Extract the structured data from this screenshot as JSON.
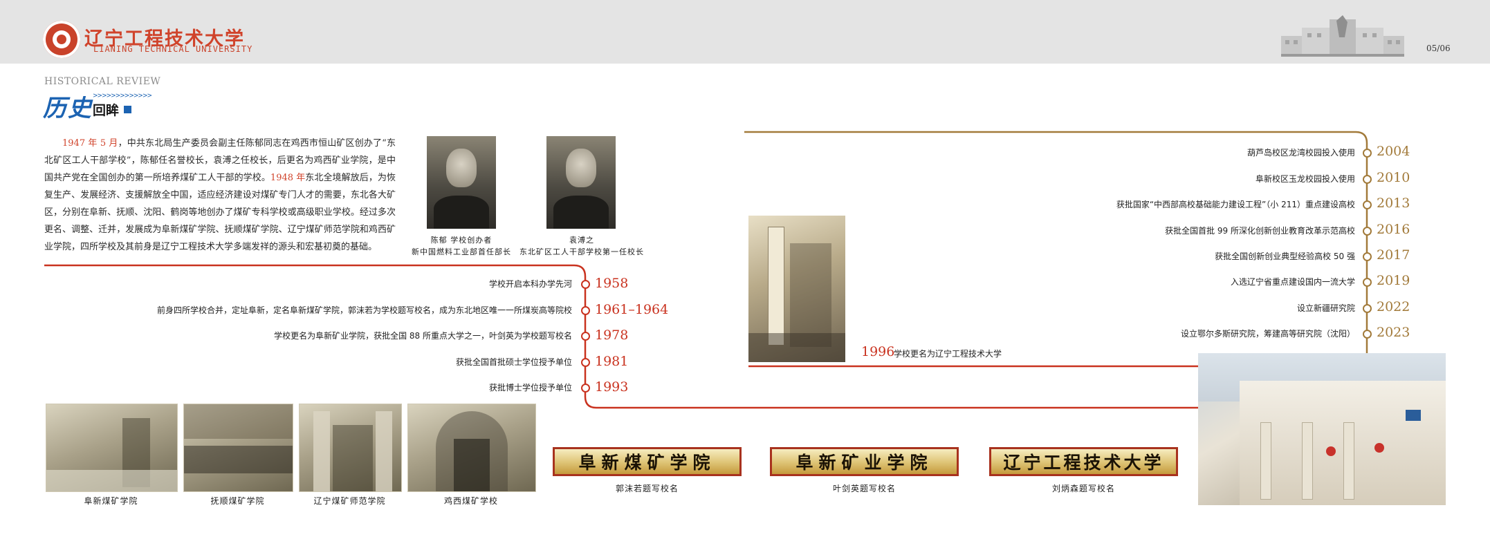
{
  "header": {
    "logo_cn": "辽宁工程技术大学",
    "logo_en": "LIANING TECHNICAL UNIVERSITY",
    "page_number": "05/06"
  },
  "section": {
    "label_en": "HISTORICAL REVIEW",
    "title_part1": "历史",
    "title_part2": "回眸",
    "arrows": ">>>>>>>>>>>>>"
  },
  "intro": {
    "year1": "1947 年 5 月",
    "text1": "，中共东北局生产委员会副主任陈郁同志在鸡西市恒山矿区创办了“东北矿区工人干部学校”，陈郁任名誉校长，袁溥之任校长，后更名为鸡西矿业学院，是中国共产党在全国创办的第一所培养煤矿工人干部的学校。",
    "year2": "1948 年",
    "text2": "东北全境解放后，为恢复生产、发展经济、支援解放全中国，适应经济建设对煤矿专门人才的需要，东北各大矿区，分别在阜新、抚顺、沈阳、鹤岗等地创办了煤矿专科学校或高级职业学校。经过多次更名、调整、迁并，发展成为阜新煤矿学院、抚顺煤矿学院、辽宁煤矿师范学院和鸡西矿业学院，四所学校及其前身是辽宁工程技术大学多端发祥的源头和宏基初奠的基础。"
  },
  "portraits": [
    {
      "caption1": "陈郁  学校创办者",
      "caption2": "新中国燃料工业部首任部长"
    },
    {
      "caption1": "袁溥之",
      "caption2": "东北矿区工人干部学校第一任校长"
    }
  ],
  "timeline_left": [
    {
      "label": "学校开启本科办学先河",
      "year": "1958"
    },
    {
      "label": "前身四所学校合并，定址阜新，定名阜新煤矿学院，郭沫若为学校题写校名，成为东北地区唯一一所煤炭高等院校",
      "year": "1961–1964"
    },
    {
      "label": "学校更名为阜新矿业学院，获批全国 88 所重点大学之一，叶剑英为学校题写校名",
      "year": "1978"
    },
    {
      "label": "获批全国首批硕士学位授予单位",
      "year": "1981"
    },
    {
      "label": "获批博士学位授予单位",
      "year": "1993"
    }
  ],
  "milestone_1996": {
    "year": "1996",
    "label": "学校更名为辽宁工程技术大学"
  },
  "timeline_right": [
    {
      "label": "葫芦岛校区龙湾校园投入使用",
      "year": "2004"
    },
    {
      "label": "阜新校区玉龙校园投入使用",
      "year": "2010"
    },
    {
      "label": "获批国家“中西部高校基础能力建设工程”（小 211）重点建设高校",
      "year": "2013"
    },
    {
      "label": "获批全国首批 99 所深化创新创业教育改革示范高校",
      "year": "2016"
    },
    {
      "label": "获批全国创新创业典型经验高校 50 强",
      "year": "2017"
    },
    {
      "label": "入选辽宁省重点建设国内一流大学",
      "year": "2019"
    },
    {
      "label": "设立新疆研究院",
      "year": "2022"
    },
    {
      "label": "设立鄂尔多斯研究院，筹建高等研究院（沈阳）",
      "year": "2023"
    }
  ],
  "photos": [
    {
      "caption": "阜新煤矿学院"
    },
    {
      "caption": "抚顺煤矿学院"
    },
    {
      "caption": "辽宁煤矿师范学院"
    },
    {
      "caption": "鸡西煤矿学校"
    }
  ],
  "plaques": [
    {
      "text": "阜新煤矿学院",
      "caption": "郭沫若题写校名"
    },
    {
      "text": "阜新矿业学院",
      "caption": "叶剑英题写校名"
    },
    {
      "text": "辽宁工程技术大学",
      "caption": "刘炳森题写校名"
    }
  ],
  "colors": {
    "red": "#c9321f",
    "brown": "#a27a3a",
    "blue": "#1c63b2"
  }
}
